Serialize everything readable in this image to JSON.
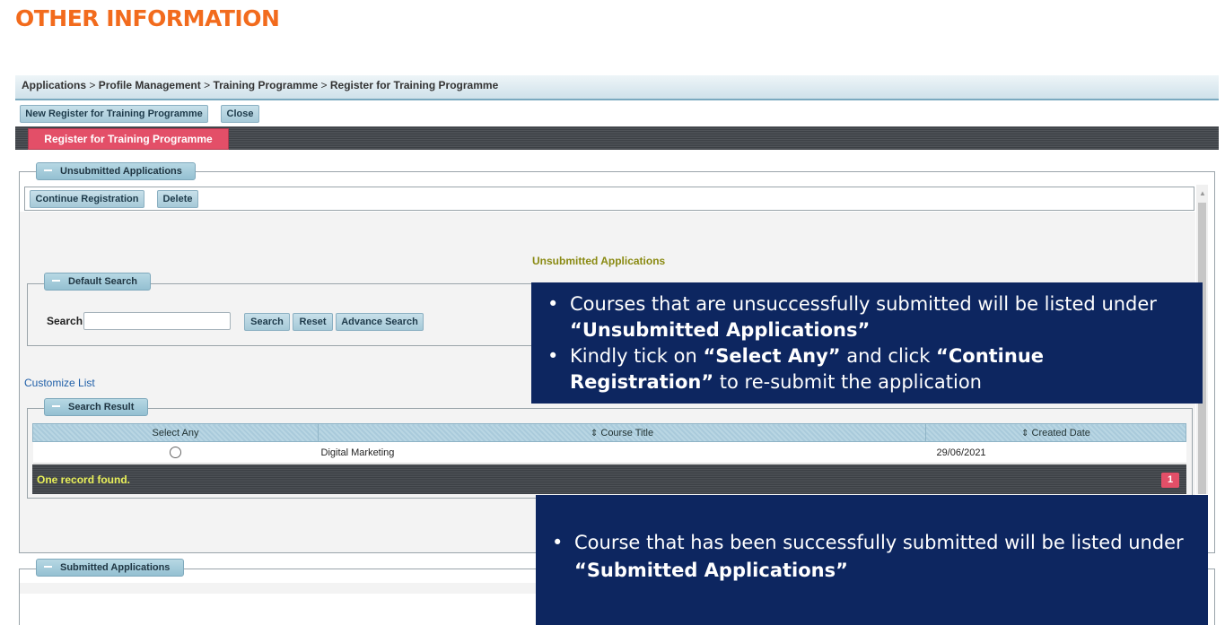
{
  "slide_title": "OTHER INFORMATION",
  "breadcrumb": {
    "items": [
      "Applications",
      "Profile Management",
      "Training Programme",
      "Register for Training Programme"
    ],
    "separator": ">"
  },
  "toolbar": {
    "new_register_label": "New Register for Training Programme",
    "close_label": "Close"
  },
  "tabs": {
    "active_label": "Register for Training Programme"
  },
  "unsubmitted": {
    "legend": "Unsubmitted Applications",
    "continue_label": "Continue Registration",
    "delete_label": "Delete",
    "section_heading": "Unsubmitted Applications"
  },
  "default_search": {
    "legend": "Default Search",
    "label": "Search",
    "input_value": "",
    "search_label": "Search",
    "reset_label": "Reset",
    "advance_label": "Advance Search"
  },
  "customize_list_label": "Customize List",
  "search_result": {
    "legend": "Search Result",
    "columns": [
      "Select Any",
      "Course Title",
      "Created Date"
    ],
    "rows": [
      {
        "course_title": "Digital Marketing",
        "created_date": "29/06/2021"
      }
    ],
    "footer_text": "One record found.",
    "page_number": "1"
  },
  "submitted": {
    "legend": "Submitted Applications"
  },
  "callout_top": {
    "bullet1_prefix": "Courses that are unsuccessfully submitted will be listed under ",
    "bullet1_quote_open": "“",
    "bullet1_bold": "Unsubmitted Applications",
    "bullet1_quote_close": "”",
    "bullet2_prefix": "Kindly tick on ",
    "bullet2_bold1": "“Select Any”",
    "bullet2_middle": " and click ",
    "bullet2_bold2": "“Continue Registration”",
    "bullet2_suffix": " to re-submit the application"
  },
  "callout_bottom": {
    "bullet_prefix": "Course that has been successfully submitted will be listed under ",
    "bullet_quote_open": "“",
    "bullet_bold": "Submitted Applications",
    "bullet_quote_close": "”"
  },
  "colors": {
    "title_orange": "#f26b1d",
    "callout_navy": "#0d2660",
    "tab_active": "#e34f68",
    "heading_olive": "#8a8a12",
    "footer_text": "#e9f05a"
  },
  "icons": {
    "sort": "sort-icon",
    "collapse": "minus-icon",
    "radio": "radio-icon"
  }
}
